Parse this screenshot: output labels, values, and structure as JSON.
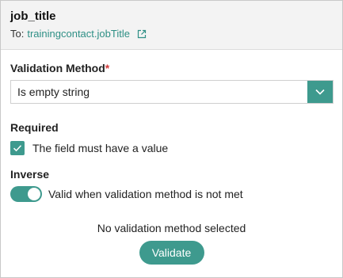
{
  "header": {
    "field_name": "job_title",
    "to_label": "To:",
    "target_link": "trainingcontact.jobTitle",
    "external_icon": "external-link-icon"
  },
  "validation_method": {
    "label": "Validation Method",
    "required_marker": "*",
    "selected_value": "Is empty string",
    "dropdown_icon": "chevron-down-icon"
  },
  "required": {
    "label": "Required",
    "checkbox_checked": true,
    "checkbox_label": "The field must have a value"
  },
  "inverse": {
    "label": "Inverse",
    "toggle_on": true,
    "toggle_label": "Valid when validation method is not met"
  },
  "status_text": "No validation method selected",
  "validate_button": "Validate",
  "colors": {
    "accent": "#3e9a8e",
    "link": "#2e8f85",
    "required_star": "#d23b3b"
  }
}
